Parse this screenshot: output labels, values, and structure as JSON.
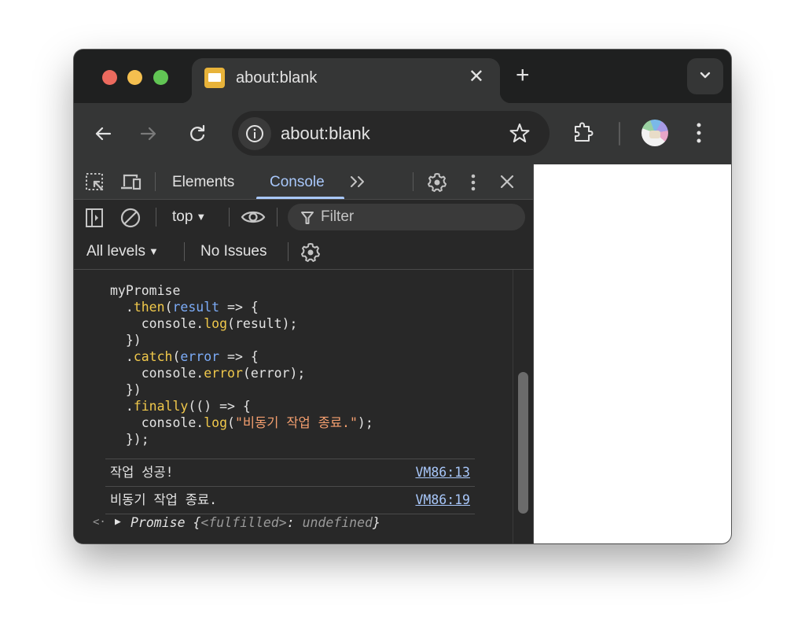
{
  "browser": {
    "tab": {
      "title": "about:blank",
      "close_glyph": "✕"
    },
    "new_tab_glyph": "+",
    "toolbar": {
      "url": "about:blank",
      "icons": [
        "back-icon",
        "forward-icon",
        "reload-icon",
        "info-icon",
        "bookmark-star-icon",
        "extensions-icon",
        "profile-avatar",
        "more-menu-icon"
      ]
    }
  },
  "devtools": {
    "tabs": [
      {
        "label": "Elements",
        "active": false
      },
      {
        "label": "Console",
        "active": true
      }
    ],
    "more_tabs_glyph": "»",
    "console_toolbar": {
      "context": "top",
      "filter_placeholder": "Filter",
      "levels": "All levels",
      "issues": "No Issues"
    },
    "code_lines": [
      "myPromise",
      "  .then(result => {",
      "    console.log(result);",
      "  })",
      "  .catch(error => {",
      "    console.error(error);",
      "  })",
      "  .finally(() => {",
      "    console.log(\"비동기 작업 종료.\");",
      "  });"
    ],
    "logs": [
      {
        "message": "작업 성공!",
        "source": "VM86:13"
      },
      {
        "message": "비동기 작업 종료.",
        "source": "VM86:19"
      }
    ],
    "result": {
      "arrow": "<·",
      "expander": "▶",
      "prefix": "Promise {",
      "state": "<fulfilled>",
      "colon": ": ",
      "value": "undefined",
      "suffix": "}"
    }
  },
  "colors": {
    "accent": "#a8c7fa",
    "method": "#f0c84b",
    "param": "#7cacf8",
    "string": "#f49f6f"
  }
}
